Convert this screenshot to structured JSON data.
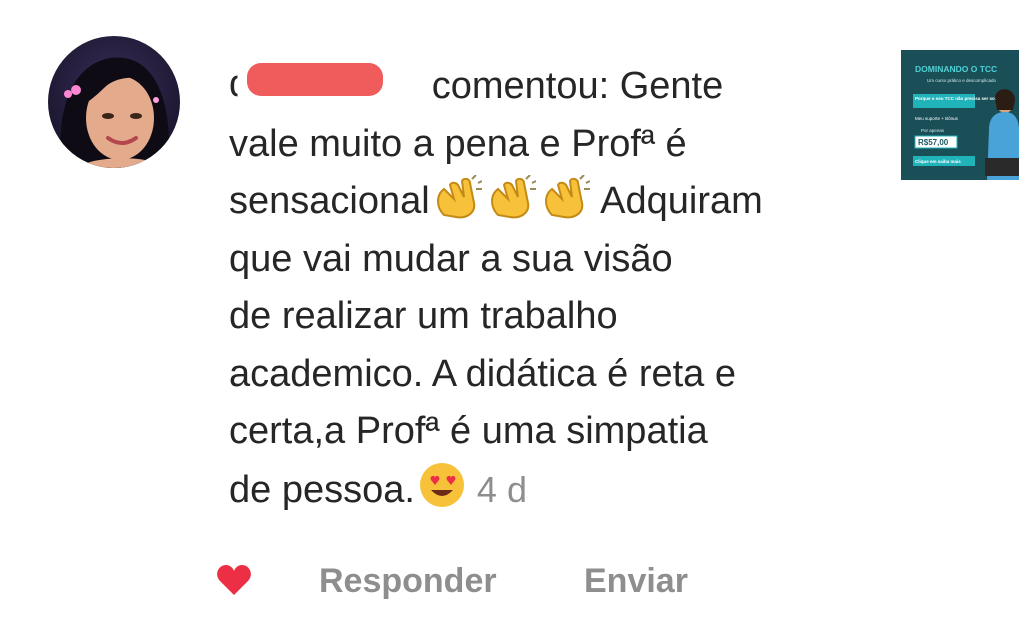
{
  "comment": {
    "username_redacted": "d",
    "lines": [
      "comentou: Gente",
      "vale muito a pena e Profª é",
      "sensacional",
      "Adquiram",
      "que vai mudar a sua visão",
      "de realizar um trabalho",
      "academico. A didática é reta e",
      "certa,a Profª é uma simpatia",
      "de pessoa."
    ],
    "timestamp": "4 d",
    "emojis": [
      "clapping-hands",
      "clapping-hands",
      "clapping-hands",
      "heart-eyes-face"
    ]
  },
  "thumbnail": {
    "title": "DOMINANDO O TCC",
    "subtitle": "Um curso prático e descomplicado",
    "tagline": "Porque o seu TCC não precisa ser sofrido!",
    "bonus": "Meu suporte + Bônus",
    "price_label": "Por apenas",
    "price": "R$57,00",
    "cta": "Clique em saiba mais"
  },
  "actions": {
    "reply_label": "Responder",
    "send_label": "Enviar"
  },
  "colors": {
    "text": "#262626",
    "muted": "#8e8e8e",
    "heart": "#ed2f45",
    "redaction": "#f05b5b",
    "thumb_bg": "#1f5a63",
    "thumb_accent": "#21b3ba"
  }
}
